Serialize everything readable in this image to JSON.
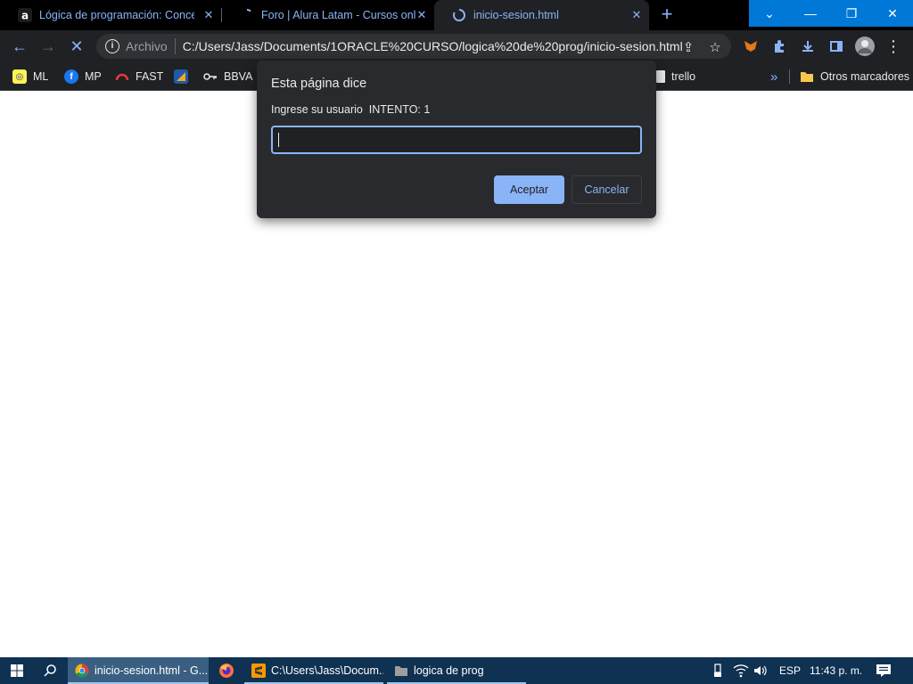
{
  "tabs": [
    {
      "title": "Lógica de programación: Concep",
      "close": "✕"
    },
    {
      "title": "Foro | Alura Latam - Cursos onlin",
      "close": "✕"
    },
    {
      "title": "inicio-sesion.html",
      "close": "✕"
    }
  ],
  "new_tab": "+",
  "window_controls": {
    "tab_search": "⌄",
    "minimize": "—",
    "restore": "❐",
    "close": "✕"
  },
  "toolbar": {
    "back": "←",
    "forward": "→",
    "stop": "✕",
    "info": "i",
    "scheme_label": "Archivo",
    "url": "C:/Users/Jass/Documents/1ORACLE%20CURSO/logica%20de%20prog/inicio-sesion.html",
    "share": "⇪",
    "star": "☆",
    "menu": "⋮"
  },
  "bookmarks": [
    {
      "label": "ML",
      "icon": "mercadolibre-icon"
    },
    {
      "label": "MP",
      "icon": "facebook-icon"
    },
    {
      "label": "FAST",
      "icon": "speedometer-icon"
    },
    {
      "label": "",
      "icon": "bookmark-app-icon"
    },
    {
      "label": "BBVA",
      "icon": "key-icon"
    },
    {
      "label": "trello",
      "icon": "trello-icon"
    }
  ],
  "bookmarks_overflow": "»",
  "other_bookmarks": "Otros marcadores",
  "dialog": {
    "title": "Esta página dice",
    "message": "Ingrese su usuario  INTENTO: 1",
    "input_value": "",
    "ok_label": "Aceptar",
    "cancel_label": "Cancelar"
  },
  "taskbar": {
    "items": [
      {
        "label": "inicio-sesion.html - G...",
        "icon": "chrome-icon"
      },
      {
        "label": "",
        "icon": "firefox-icon"
      },
      {
        "label": "C:\\Users\\Jass\\Docum...",
        "icon": "sublime-text-icon"
      },
      {
        "label": "logica de prog",
        "icon": "folder-icon"
      }
    ],
    "language": "ESP",
    "time": "11:43 p. m."
  },
  "colors": {
    "accent": "#8ab4f8",
    "taskbar": "#0f3152",
    "window_blue": "#0078d7"
  }
}
